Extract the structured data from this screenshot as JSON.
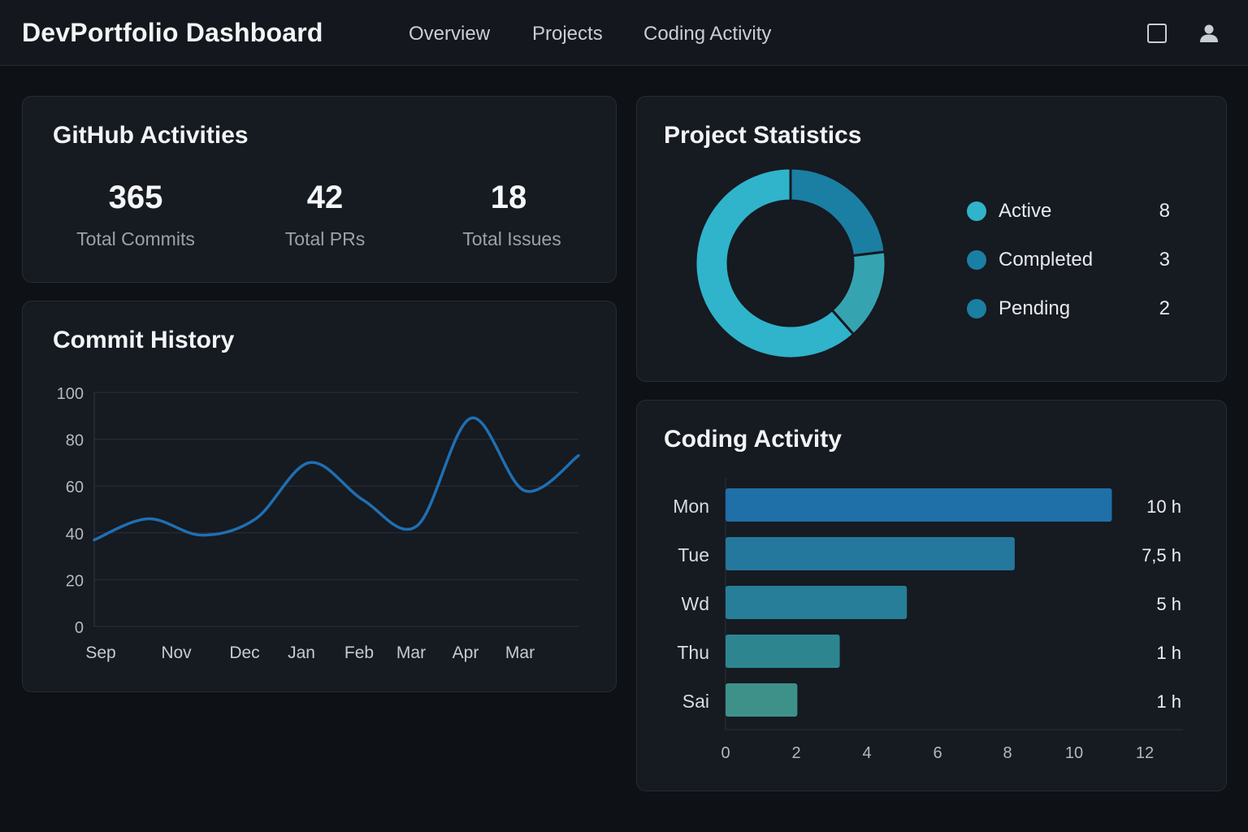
{
  "app": {
    "title": "DevPortfolio Dashboard"
  },
  "nav": [
    {
      "label": "Overview"
    },
    {
      "label": "Projects"
    },
    {
      "label": "Coding Activity"
    }
  ],
  "header_icons": [
    "square-icon",
    "user-icon"
  ],
  "github": {
    "title": "GitHub Activities",
    "stats": [
      {
        "value": "365",
        "label": "Total Commits"
      },
      {
        "value": "42",
        "label": "Total PRs"
      },
      {
        "value": "18",
        "label": "Total Issues"
      }
    ]
  },
  "commit_history": {
    "title": "Commit History"
  },
  "project_stats": {
    "title": "Project Statistics",
    "items": [
      {
        "label": "Active",
        "count": "8",
        "color": "#2fb4cc"
      },
      {
        "label": "Completed",
        "count": "3",
        "color": "#1a7fa3"
      },
      {
        "label": "Pending",
        "count": "2",
        "color": "#1a7fa3"
      }
    ]
  },
  "coding_activity": {
    "title": "Coding Activity"
  },
  "chart_data": [
    {
      "type": "line",
      "title": "Commit History",
      "categories": [
        "Sep",
        "Nov",
        "Dec",
        "Jan",
        "Feb",
        "Mar",
        "Apr",
        "Mar"
      ],
      "series": [
        {
          "values": [
            37,
            46,
            39,
            46,
            70,
            54,
            43,
            89,
            58,
            73
          ]
        }
      ],
      "yticks": [
        0,
        20,
        40,
        60,
        80,
        100
      ],
      "ylim": [
        0,
        100
      ],
      "grid": true,
      "color": "#1f6fb2"
    },
    {
      "type": "pie",
      "title": "Project Statistics",
      "donut": true,
      "slices": [
        {
          "label": "Active",
          "value": 8,
          "color": "#2fb4cc"
        },
        {
          "label": "Completed",
          "value": 3,
          "color": "#1a7fa3"
        },
        {
          "label": "Pending",
          "value": 2,
          "color": "#36a3b0"
        }
      ]
    },
    {
      "type": "bar",
      "orientation": "horizontal",
      "title": "Coding Activity",
      "categories": [
        "Mon",
        "Tue",
        "Wd",
        "Thu",
        "Sai"
      ],
      "values": [
        11,
        8.25,
        5.2,
        3.3,
        2.1
      ],
      "value_labels": [
        "10 h",
        "7,5 h",
        "5 h",
        "1 h",
        "1 h"
      ],
      "xticks": [
        0,
        2,
        4,
        6,
        8,
        10,
        12
      ],
      "xlim": [
        0,
        13
      ],
      "colors": [
        "#1f6fa8",
        "#24789e",
        "#277e98",
        "#2d8590",
        "#3e9189"
      ]
    }
  ]
}
